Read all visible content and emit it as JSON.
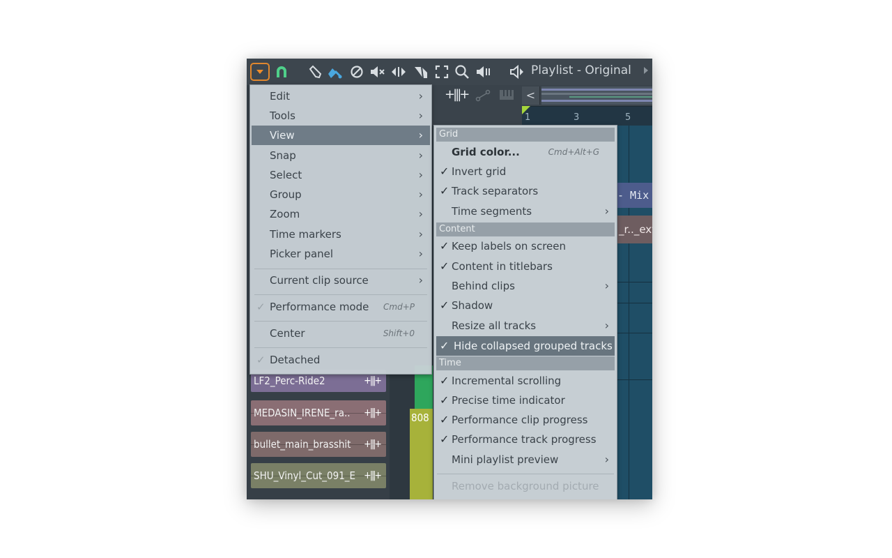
{
  "toolbar": {
    "title": "Playlist - Original",
    "icons": [
      "menu-arrow-icon",
      "magnet-snap-icon",
      "pencil-icon",
      "paint-brush-icon",
      "delete-circle-icon",
      "mute-icon",
      "slip-icon",
      "slice-icon",
      "select-icon",
      "zoom-icon",
      "playback-icon",
      "speaker-icon"
    ]
  },
  "playlist": {
    "ruler_numbers": [
      "1",
      "3",
      "5"
    ],
    "scroll_left": "<",
    "clips": {
      "olive": "808",
      "mix": "- Mix",
      "ext": "_r.._ext"
    }
  },
  "picker": {
    "tracks": [
      {
        "name": "LF2_Perc-Ride2",
        "color": "#7c6e95"
      },
      {
        "name": "MEDASIN_IRENE_ra..",
        "color": "#8a6e74"
      },
      {
        "name": "bullet_main_brasshit",
        "color": "#7e6a6a"
      },
      {
        "name": "SHU_Vinyl_Cut_091_E",
        "color": "#7a8066"
      }
    ]
  },
  "main_menu": {
    "items": [
      {
        "label": "Edit",
        "submenu": true
      },
      {
        "label": "Tools",
        "submenu": true
      },
      {
        "label": "View",
        "submenu": true,
        "active": true
      },
      {
        "label": "Snap",
        "submenu": true
      },
      {
        "label": "Select",
        "submenu": true
      },
      {
        "label": "Group",
        "submenu": true
      },
      {
        "label": "Zoom",
        "submenu": true
      },
      {
        "label": "Time markers",
        "submenu": true
      },
      {
        "label": "Picker panel",
        "submenu": true
      },
      {
        "label": "Current clip source",
        "submenu": true
      },
      {
        "label": "Performance mode",
        "shortcut": "Cmd+P",
        "checked": false
      },
      {
        "label": "Center",
        "shortcut": "Shift+0"
      },
      {
        "label": "Detached",
        "checked": false
      }
    ],
    "check_glyph": "✓",
    "chevron": "›"
  },
  "view_menu": {
    "sections": {
      "grid": "Grid",
      "content": "Content",
      "time": "Time"
    },
    "items": [
      {
        "label": "Grid color...",
        "shortcut": "Cmd+Alt+G",
        "checked": false
      },
      {
        "label": "Invert grid",
        "checked": true
      },
      {
        "label": "Track separators",
        "checked": true
      },
      {
        "label": "Time segments",
        "submenu": true
      },
      {
        "label": "Keep labels on screen",
        "checked": true
      },
      {
        "label": "Content in titlebars",
        "checked": true
      },
      {
        "label": "Behind clips",
        "submenu": true
      },
      {
        "label": "Shadow",
        "checked": true
      },
      {
        "label": "Resize all tracks",
        "submenu": true
      },
      {
        "label": "Hide collapsed grouped tracks",
        "checked": true,
        "highlighted": true
      },
      {
        "label": "Incremental scrolling",
        "checked": true
      },
      {
        "label": "Precise time indicator",
        "checked": true
      },
      {
        "label": "Performance clip progress",
        "checked": true
      },
      {
        "label": "Performance track progress",
        "checked": true
      },
      {
        "label": "Mini playlist preview",
        "submenu": true
      },
      {
        "label": "Remove background picture",
        "disabled": true
      }
    ]
  }
}
